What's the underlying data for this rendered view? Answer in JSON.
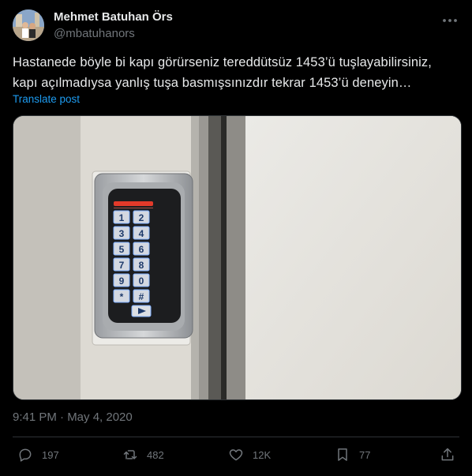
{
  "author": {
    "display_name": "Mehmet Batuhan Örs",
    "handle": "@mbatuhanors",
    "avatar_icon": "user-avatar-photo"
  },
  "post": {
    "text_lines": [
      "Hastanede böyle bi kapı görürseniz tereddütsüz 1453’ü tuşlayabilirsiniz,",
      "kapı açılmadıysa yanlış tuşa basmışsınızdır tekrar 1453’ü deneyin…"
    ],
    "translate_label": "Translate post",
    "timestamp": "9:41 PM · May 4, 2020"
  },
  "media": {
    "description_icon": "door-keypad-photo",
    "keypad": {
      "keys": [
        "1",
        "2",
        "3",
        "4",
        "5",
        "6",
        "7",
        "8",
        "9",
        "0",
        "*",
        "#"
      ]
    }
  },
  "actions": {
    "replies": "197",
    "reposts": "482",
    "likes": "12K",
    "bookmarks": "77"
  },
  "colors": {
    "background": "#000000",
    "text": "#e7e9ea",
    "muted": "#71767b",
    "accent": "#1d9bf0",
    "border": "#2f3336"
  }
}
